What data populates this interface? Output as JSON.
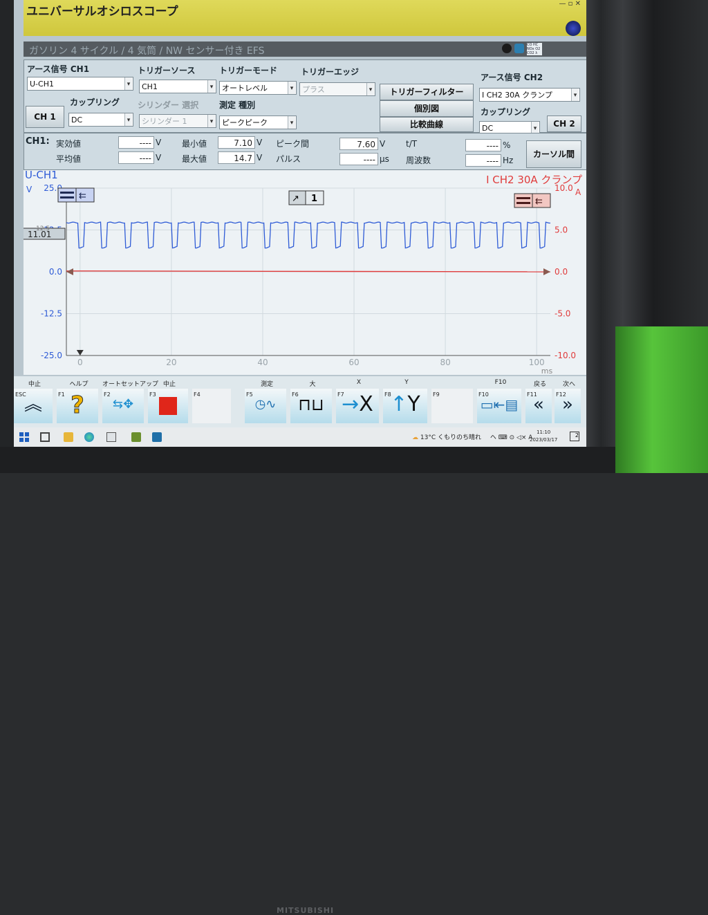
{
  "app": {
    "title": "ユニバーサルオシロスコープ",
    "window_controls": "—  ▫  ✕",
    "mode_text": "ガソリン 4 サイクル / 4 気筒 / NW センサー付き EFS",
    "mini_icon_text": "CO HC\nNOx O2\nCO2 λ",
    "brand": "MITSUBISHI"
  },
  "settings": {
    "ch1_signal_label": "アース信号 CH1",
    "ch1_signal_value": "U-CH1",
    "ch1_button": "CH 1",
    "coupling_label": "カップリング",
    "coupling_value": "DC",
    "trigger_source_label": "トリガーソース",
    "trigger_source_value": "CH1",
    "cylinder_label": "シリンダー 選択",
    "cylinder_value": "シリンダー 1",
    "trigger_mode_label": "トリガーモード",
    "trigger_mode_value": "オートレベル",
    "measure_type_label": "測定 種別",
    "measure_type_value": "ピークピーク",
    "trigger_edge_label": "トリガーエッジ",
    "trigger_edge_value": "プラス",
    "trigger_filter_button": "トリガーフィルター",
    "individual_button": "個別図",
    "compare_button": "比較曲線",
    "ch2_signal_label": "アース信号 CH2",
    "ch2_signal_value": "I CH2 30A クランプ",
    "ch2_coupling_label": "カップリング",
    "ch2_coupling_value": "DC",
    "ch2_button": "CH 2"
  },
  "measurements": {
    "channel_label": "CH1:",
    "rms_label": "実効値",
    "rms_value": "----",
    "rms_unit": "V",
    "avg_label": "平均値",
    "avg_value": "----",
    "avg_unit": "V",
    "min_label": "最小値",
    "min_value": "7.10",
    "min_unit": "V",
    "max_label": "最大値",
    "max_value": "14.7",
    "max_unit": "V",
    "pp_label": "ピーク間",
    "pp_value": "7.60",
    "pp_unit": "V",
    "pulse_label": "パルス",
    "pulse_value": "----",
    "pulse_unit": "μs",
    "duty_label": "t/T",
    "duty_value": "----",
    "duty_unit": "%",
    "freq_label": "周波数",
    "freq_value": "----",
    "freq_unit": "Hz",
    "cursor_button": "カーソル間"
  },
  "scope": {
    "ch1_name": "U-CH1",
    "ch2_name": "I CH2 30A クランプ",
    "y_left_unit": "V",
    "y_right_unit": "A",
    "trigger_badge": "1",
    "cursor_readout": "11.01",
    "hidden_tick": "12.5",
    "x_unit": "ms",
    "ch1_color": "#2e5bd6",
    "ch2_color": "#e03b3b"
  },
  "chart_data": {
    "type": "line",
    "x_ticks": [
      "0",
      "20",
      "40",
      "60",
      "80",
      "100"
    ],
    "y_left_ticks": [
      "25.0",
      "12.5",
      "0.0",
      "-12.5",
      "-25.0"
    ],
    "y_right_ticks": [
      "10.0",
      "5.0",
      "0.0",
      "-5.0",
      "-10.0"
    ],
    "xlim": [
      -3,
      103
    ],
    "ylim_left": [
      -25,
      25
    ],
    "ylim_right": [
      -10,
      10
    ],
    "grid": true,
    "series": [
      {
        "name": "U-CH1",
        "axis": "left",
        "baseline": 14.7,
        "dip_min": 7.1,
        "dip_times_ms": [
          0,
          5.1,
          10.2,
          15.3,
          20.4,
          25.5,
          30.6,
          35.7,
          40.8,
          45.9,
          51.0,
          56.1,
          61.2,
          66.3,
          71.4,
          76.5,
          81.6,
          86.7,
          91.8,
          96.9,
          101.0
        ]
      },
      {
        "name": "I CH2 30A クランプ",
        "axis": "right",
        "x": [
          -3,
          103
        ],
        "y": [
          0.1,
          0.0
        ]
      }
    ]
  },
  "fkeys": [
    {
      "name": "中止",
      "code": "ESC",
      "icon": "chevron-up-icon"
    },
    {
      "name": "ヘルプ",
      "code": "F1",
      "icon": "help-icon"
    },
    {
      "name": "オートセットアップ",
      "code": "F2",
      "icon": "autoset-icon"
    },
    {
      "name": "中止",
      "code": "F3",
      "icon": "stop-icon"
    },
    {
      "name": "",
      "code": "F4",
      "icon": ""
    },
    {
      "name": "測定",
      "code": "F5",
      "icon": "measure-icon"
    },
    {
      "name": "大",
      "code": "F6",
      "icon": "zoom-signal-icon"
    },
    {
      "name": "X",
      "code": "F7",
      "icon": "x-cursor-icon",
      "glyph": "X"
    },
    {
      "name": "Y",
      "code": "F8",
      "icon": "y-cursor-icon",
      "glyph": "Y"
    },
    {
      "name": "",
      "code": "F9",
      "icon": ""
    },
    {
      "name": "F10",
      "code": "F10",
      "icon": "layout-icon"
    },
    {
      "name": "戻る",
      "code": "F11",
      "icon": "back-icon"
    },
    {
      "name": "次へ",
      "code": "F12",
      "icon": "next-icon"
    }
  ],
  "taskbar": {
    "weather": "13°C くもりのち晴れ",
    "tray_icons": "ヘ ⌨ ⊙ ◁× A",
    "time": "11:10",
    "date": "2023/03/17",
    "notification_count": "2"
  }
}
